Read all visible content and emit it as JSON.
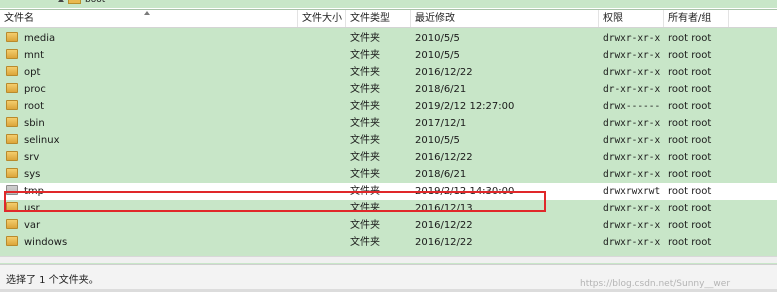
{
  "breadcrumb": {
    "label": "boot"
  },
  "columns": {
    "name": "文件名",
    "size": "文件大小",
    "type": "文件类型",
    "modified": "最近修改",
    "permissions": "权限",
    "owner": "所有者/组"
  },
  "rows": [
    {
      "name": "media",
      "type": "文件夹",
      "modified": "2010/5/5",
      "perm": "drwxr-xr-x",
      "owner": "root root",
      "icon": "folder-icon"
    },
    {
      "name": "mnt",
      "type": "文件夹",
      "modified": "2010/5/5",
      "perm": "drwxr-xr-x",
      "owner": "root root",
      "icon": "folder-icon"
    },
    {
      "name": "opt",
      "type": "文件夹",
      "modified": "2016/12/22",
      "perm": "drwxr-xr-x",
      "owner": "root root",
      "icon": "folder-icon"
    },
    {
      "name": "proc",
      "type": "文件夹",
      "modified": "2018/6/21",
      "perm": "dr-xr-xr-x",
      "owner": "root root",
      "icon": "folder-icon"
    },
    {
      "name": "root",
      "type": "文件夹",
      "modified": "2019/2/12 12:27:00",
      "perm": "drwx------",
      "owner": "root root",
      "icon": "folder-icon"
    },
    {
      "name": "sbin",
      "type": "文件夹",
      "modified": "2017/12/1",
      "perm": "drwxr-xr-x",
      "owner": "root root",
      "icon": "folder-icon"
    },
    {
      "name": "selinux",
      "type": "文件夹",
      "modified": "2010/5/5",
      "perm": "drwxr-xr-x",
      "owner": "root root",
      "icon": "folder-icon"
    },
    {
      "name": "srv",
      "type": "文件夹",
      "modified": "2016/12/22",
      "perm": "drwxr-xr-x",
      "owner": "root root",
      "icon": "folder-icon"
    },
    {
      "name": "sys",
      "type": "文件夹",
      "modified": "2018/6/21",
      "perm": "drwxr-xr-x",
      "owner": "root root",
      "icon": "folder-icon"
    },
    {
      "name": "tmp",
      "type": "文件夹",
      "modified": "2019/2/12 14:30:00",
      "perm": "drwxrwxrwt",
      "owner": "root root",
      "icon": "folder-plain-icon",
      "selected": true
    },
    {
      "name": "usr",
      "type": "文件夹",
      "modified": "2016/12/13",
      "perm": "drwxr-xr-x",
      "owner": "root root",
      "icon": "folder-icon"
    },
    {
      "name": "var",
      "type": "文件夹",
      "modified": "2016/12/22",
      "perm": "drwxr-xr-x",
      "owner": "root root",
      "icon": "folder-icon"
    },
    {
      "name": "windows",
      "type": "文件夹",
      "modified": "2016/12/22",
      "perm": "drwxr-xr-x",
      "owner": "root root",
      "icon": "folder-icon"
    }
  ],
  "status": {
    "text": "选择了 1 个文件夹。",
    "watermark": "https://blog.csdn.net/Sunny__wer"
  },
  "colors": {
    "pane_bg": "#c8e6c8",
    "highlight_border": "#e0282a",
    "selected_row_bg": "#ffffff"
  }
}
